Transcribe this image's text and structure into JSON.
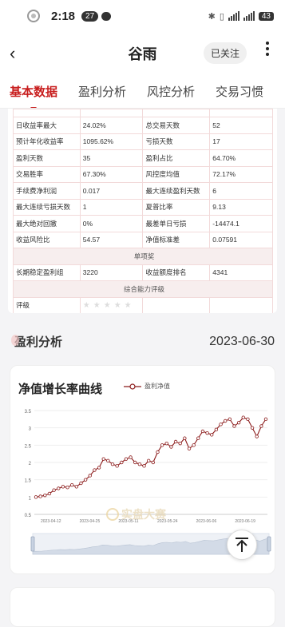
{
  "status": {
    "time": "2:18",
    "notif_count": "27",
    "battery": "43"
  },
  "nav": {
    "title": "谷雨",
    "follow_label": "已关注"
  },
  "tabs": [
    {
      "label": "基本数据"
    },
    {
      "label": "盈利分析"
    },
    {
      "label": "风控分析"
    },
    {
      "label": "交易习惯"
    }
  ],
  "stats": {
    "rows": [
      {
        "k1": "日收益率最大",
        "v1": "24.02%",
        "k2": "总交易天数",
        "v2": "52"
      },
      {
        "k1": "预计年化收益率",
        "v1": "1095.62%",
        "k2": "亏损天数",
        "v2": "17"
      },
      {
        "k1": "盈利天数",
        "v1": "35",
        "k2": "盈利占比",
        "v2": "64.70%"
      },
      {
        "k1": "交易胜率",
        "v1": "67.30%",
        "k2": "风控度均值",
        "v2": "72.17%"
      },
      {
        "k1": "手续费净利润",
        "v1": "0.017",
        "k2": "最大连续盈利天数",
        "v2": "6"
      },
      {
        "k1": "最大连续亏损天数",
        "v1": "1",
        "k2": "夏普比率",
        "v2": "9.13"
      },
      {
        "k1": "最大绝对回撤",
        "v1": "0%",
        "k2": "最差单日亏损",
        "v2": "-14474.1"
      },
      {
        "k1": "收益风险比",
        "v1": "54.57",
        "k2": "净值标准差",
        "v2": "0.07591"
      }
    ],
    "section1": "单项奖",
    "award": {
      "k1": "长期稳定盈利组",
      "v1": "3220",
      "k2": "收益额度排名",
      "v2": "4341"
    },
    "section2": "综合能力评级",
    "rating_label": "评级",
    "stars": "★★★★★"
  },
  "profit": {
    "title": "盈利分析",
    "date": "2023-06-30"
  },
  "chart_data": {
    "type": "line",
    "title": "净值增长率曲线",
    "series_name": "盈利净值",
    "ylim": [
      0.5,
      3.5
    ],
    "yticks": [
      "3.5",
      "3",
      "2.5",
      "2",
      "1.5",
      "1",
      "0.5"
    ],
    "x_ticks": [
      "2023-04-12",
      "2023-04-25",
      "2023-05-11",
      "2023-05-24",
      "2023-06-06",
      "2023-06-19"
    ],
    "values": [
      1.0,
      1.02,
      1.05,
      1.1,
      1.2,
      1.25,
      1.3,
      1.28,
      1.35,
      1.3,
      1.4,
      1.5,
      1.62,
      1.78,
      1.85,
      2.1,
      2.05,
      1.95,
      1.9,
      2.0,
      2.1,
      2.15,
      2.0,
      1.95,
      1.9,
      2.05,
      2.0,
      2.3,
      2.5,
      2.55,
      2.45,
      2.6,
      2.55,
      2.7,
      2.4,
      2.5,
      2.7,
      2.9,
      2.85,
      2.8,
      2.95,
      3.1,
      3.2,
      3.25,
      3.05,
      3.15,
      3.3,
      3.25,
      3.0,
      2.75,
      3.05,
      3.25
    ],
    "watermark": "实盘大赛"
  }
}
